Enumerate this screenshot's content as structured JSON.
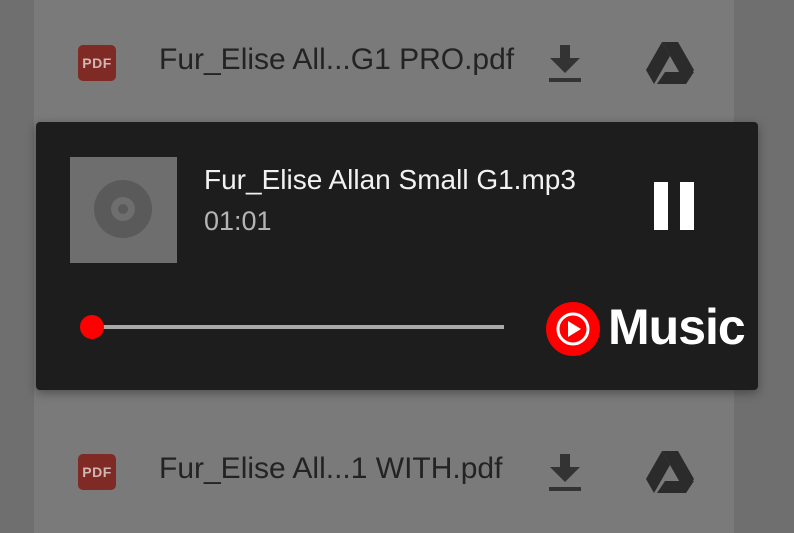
{
  "files": [
    {
      "type_badge": "PDF",
      "name": "Fur_Elise All...G1 PRO.pdf"
    },
    {
      "type_badge": "PDF",
      "name": "Fur_Elise All...1 WITH.pdf"
    }
  ],
  "player": {
    "track_title": "Fur_Elise Allan Small G1.mp3",
    "elapsed_time": "01:01",
    "progress_fraction": 0.02,
    "brand_label": "Music",
    "state": "playing"
  },
  "colors": {
    "accent": "#ff0000",
    "player_bg": "#1d1d1d",
    "pdf_badge": "#7f2a24"
  },
  "icons": {
    "file_type": "pdf-icon",
    "download": "download-icon",
    "drive": "google-drive-icon",
    "pause": "pause-icon",
    "album_art": "album-art-disc-icon",
    "brand": "youtube-music-icon"
  }
}
